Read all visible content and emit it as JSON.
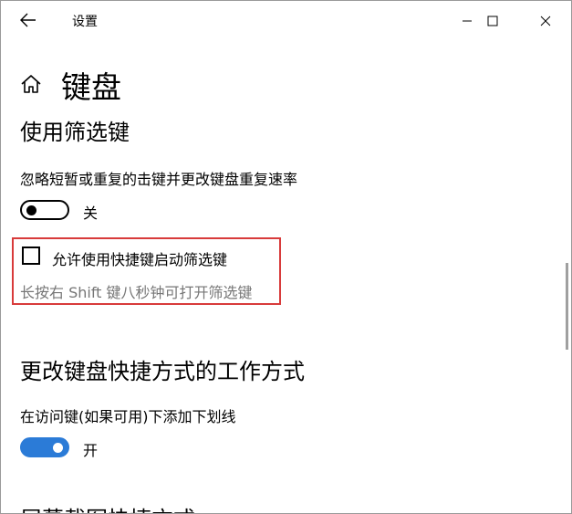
{
  "window": {
    "title": "设置"
  },
  "header": {
    "page_title": "键盘"
  },
  "filter_keys": {
    "section_title": "使用筛选键",
    "description": "忽略短暂或重复的击键并更改键盘重复速率",
    "toggle_state": "关",
    "checkbox_label": "允许使用快捷键启动筛选键",
    "hint": "长按右 Shift 键八秒钟可打开筛选键"
  },
  "shortcuts": {
    "section_title": "更改键盘快捷方式的工作方式",
    "description": "在访问键(如果可用)下添加下划线",
    "toggle_state": "开"
  },
  "print_screen": {
    "section_title": "屏幕截图快捷方式"
  },
  "colors": {
    "toggle_on": "#2b7bd7",
    "highlight_border": "#d83b3b",
    "hint_text": "#767676"
  }
}
